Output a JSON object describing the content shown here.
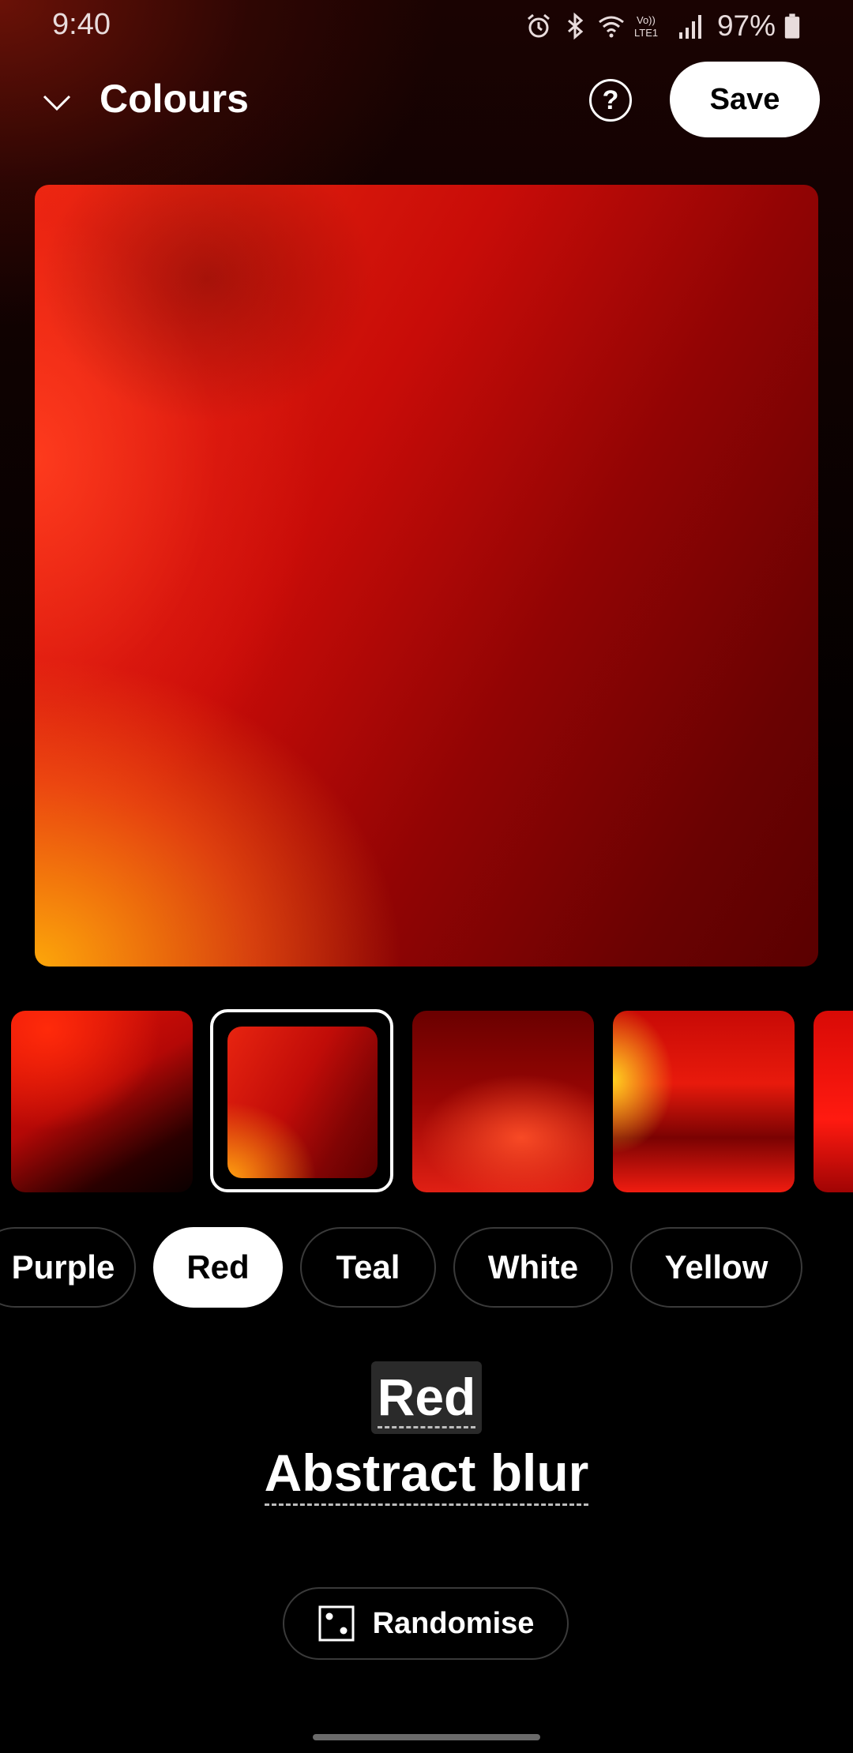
{
  "status_bar": {
    "time": "9:40",
    "network_label": "Vo)) LTE1",
    "battery_percent": "97%",
    "icons": [
      "alarm-icon",
      "bluetooth-icon",
      "wifi-icon",
      "volte-icon",
      "signal-icon",
      "battery-icon"
    ]
  },
  "header": {
    "title": "Colours",
    "help_label": "?",
    "save_label": "Save"
  },
  "preview": {
    "colors": [
      "#f02a10",
      "#c80c08",
      "#6a0202",
      "#ffaf0a"
    ]
  },
  "thumbnails": {
    "selected_index": 1,
    "count_visible": 5
  },
  "chips": [
    {
      "label": "Purple",
      "selected": false
    },
    {
      "label": "Red",
      "selected": true
    },
    {
      "label": "Teal",
      "selected": false
    },
    {
      "label": "White",
      "selected": false
    },
    {
      "label": "Yellow",
      "selected": false
    }
  ],
  "labels": {
    "color_name": "Red",
    "style_name": "Abstract blur"
  },
  "randomise": {
    "label": "Randomise"
  }
}
